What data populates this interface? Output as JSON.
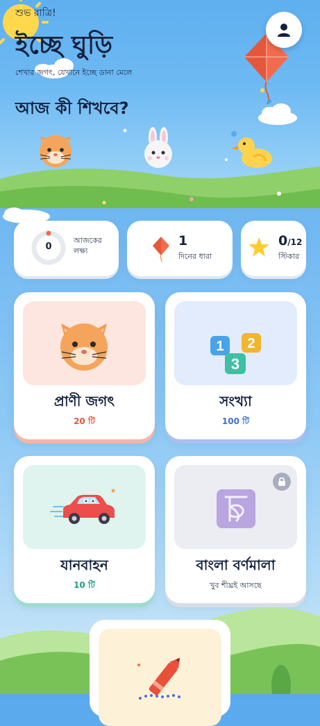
{
  "header": {
    "greeting": "শুভ রাত্রি!",
    "app_title": "ইচ্ছে ঘুড়ি",
    "tagline": "শেখার জগৎ, যেখানে ইচ্ছে ডানা মেলে",
    "question": "আজ কী শিখবে?",
    "profile_icon": "user-icon"
  },
  "stats": {
    "goal": {
      "value": "0",
      "label_line1": "আজকের",
      "label_line2": "লক্ষ্য",
      "progress": 0
    },
    "streak": {
      "value": "1",
      "label": "দিনের ধারা",
      "icon": "kite-icon"
    },
    "stickers": {
      "value": "0",
      "total": "/12",
      "label": "স্টিকার",
      "icon": "star-icon"
    }
  },
  "categories": [
    {
      "title": "প্রাণী জগৎ",
      "count": "20 টি",
      "count_color": "#e8573f",
      "bg": "#fde6df",
      "shadow": "#f4b6a6",
      "icon": "cat-icon"
    },
    {
      "title": "সংখ্যা",
      "count": "100 টি",
      "count_color": "#3d6fd6",
      "bg": "#e3ecfd",
      "shadow": "#a9bff2",
      "icon": "numbers-icon"
    },
    {
      "title": "যানবাহন",
      "count": "10 টি",
      "count_color": "#1f9e86",
      "bg": "#dff3ef",
      "shadow": "#9edccd",
      "icon": "car-icon"
    },
    {
      "title": "বাংলা বর্ণমালা",
      "count": "খুব শীঘ্রই আসছে",
      "count_color": "#2b3550",
      "bg": "#ececf3",
      "shadow": "#d9dde6",
      "icon": "bangla-letter-icon",
      "locked": true,
      "lock_icon": "lock-icon"
    },
    {
      "title": "",
      "count": "",
      "count_color": "#2b3550",
      "bg": "#fdf1d8",
      "shadow": "#f3dfae",
      "icon": "crayon-icon"
    }
  ],
  "colors": {
    "sky": "#6db9f3",
    "grass": "#79c257",
    "title": "#14213d"
  }
}
